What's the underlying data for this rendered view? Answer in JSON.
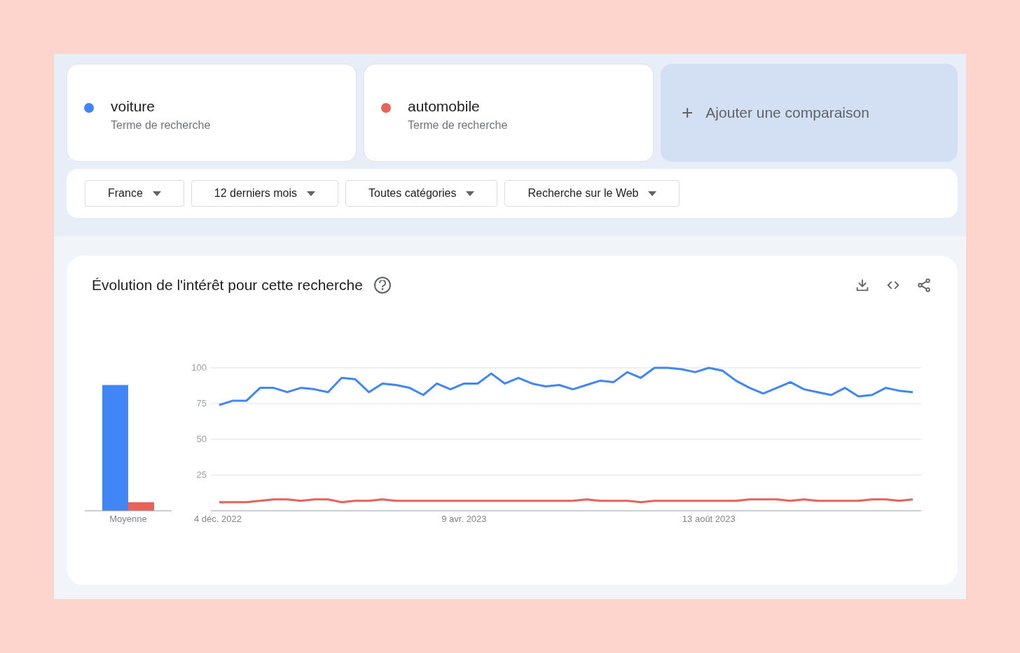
{
  "terms": [
    {
      "term": "voiture",
      "subtitle": "Terme de recherche",
      "color": "#4285f4"
    },
    {
      "term": "automobile",
      "subtitle": "Terme de recherche",
      "color": "#e8625a"
    }
  ],
  "add_comparison": {
    "icon": "+",
    "label": "Ajouter une comparaison"
  },
  "filters": [
    "France",
    "12 derniers mois",
    "Toutes catégories",
    "Recherche sur le Web"
  ],
  "panel": {
    "title": "Évolution de l'intérêt pour cette recherche",
    "average_chart": {
      "chart_data": {
        "type": "bar",
        "categories": [
          "Moyenne"
        ],
        "ylim": [
          0,
          100
        ],
        "series": [
          {
            "color": "#4285f4",
            "values": [
              88
            ]
          },
          {
            "color": "#e8625a",
            "values": [
              6
            ]
          }
        ]
      }
    },
    "chart_data": {
      "type": "line",
      "grid": true,
      "ylim": [
        0,
        100
      ],
      "yticks": [
        25,
        50,
        75,
        100
      ],
      "categories": [
        "4 déc. 2022",
        null,
        null,
        null,
        null,
        null,
        null,
        null,
        null,
        null,
        null,
        null,
        null,
        null,
        null,
        null,
        null,
        null,
        "9 avr. 2023",
        null,
        null,
        null,
        null,
        null,
        null,
        null,
        null,
        null,
        null,
        null,
        null,
        null,
        null,
        null,
        null,
        null,
        "13 août 2023",
        null,
        null,
        null,
        null,
        null,
        null,
        null,
        null,
        null,
        null,
        null,
        null,
        null,
        null,
        null
      ],
      "series": [
        {
          "color": "#4285f4",
          "values": [
            74,
            77,
            77,
            86,
            86,
            83,
            86,
            85,
            83,
            93,
            92,
            83,
            89,
            88,
            86,
            81,
            89,
            85,
            89,
            89,
            96,
            89,
            93,
            89,
            87,
            88,
            85,
            88,
            91,
            90,
            97,
            93,
            100,
            100,
            99,
            97,
            100,
            98,
            91,
            86,
            82,
            86,
            90,
            85,
            83,
            81,
            86,
            80,
            81,
            86,
            84,
            83
          ]
        },
        {
          "color": "#e8625a",
          "values": [
            6,
            6,
            6,
            7,
            8,
            8,
            7,
            8,
            8,
            6,
            7,
            7,
            8,
            7,
            7,
            7,
            7,
            7,
            7,
            7,
            7,
            7,
            7,
            7,
            7,
            7,
            7,
            8,
            7,
            7,
            7,
            6,
            7,
            7,
            7,
            7,
            7,
            7,
            7,
            8,
            8,
            8,
            7,
            8,
            7,
            7,
            7,
            7,
            8,
            8,
            7,
            8
          ]
        }
      ]
    }
  }
}
